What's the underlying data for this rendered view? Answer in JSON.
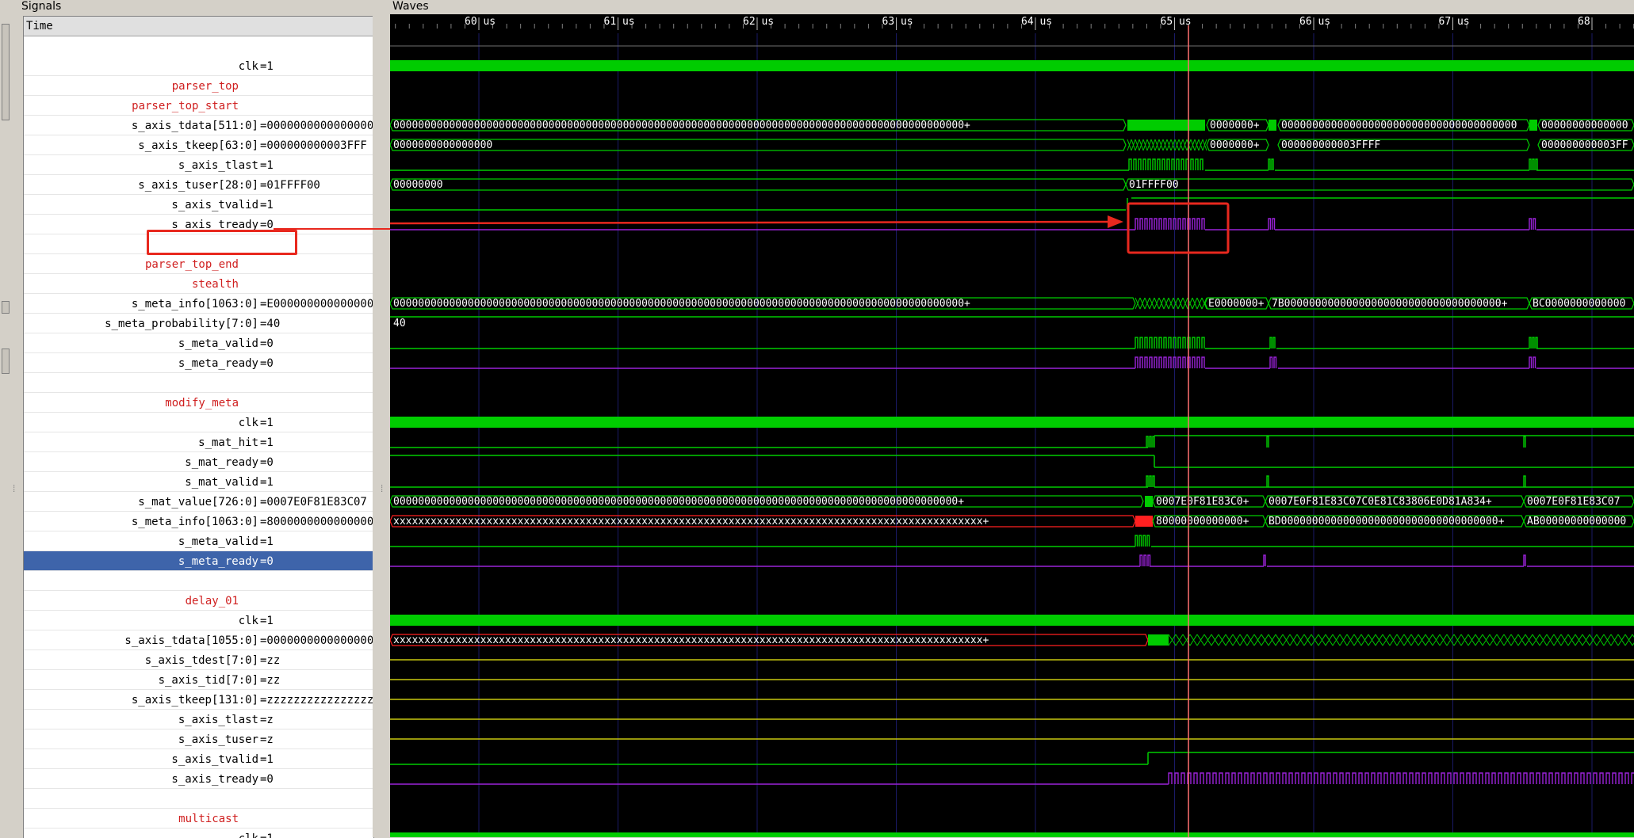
{
  "panels": {
    "signals_title": "Signals",
    "waves_title": "Waves"
  },
  "signals": {
    "header": "Time",
    "rows": [
      {
        "name": "clk",
        "value": "=1"
      },
      {
        "name": "parser_top",
        "value": "",
        "group": true
      },
      {
        "name": "parser_top_start",
        "value": "",
        "group": true
      },
      {
        "name": "s_axis_tdata[511:0]",
        "value": "=0000000000000000"
      },
      {
        "name": "s_axis_tkeep[63:0]",
        "value": "=000000000003FFF"
      },
      {
        "name": "s_axis_tlast",
        "value": "=1"
      },
      {
        "name": "s_axis_tuser[28:0]",
        "value": "=01FFFF00"
      },
      {
        "name": "s_axis_tvalid",
        "value": "=1"
      },
      {
        "name": "s_axis_tready",
        "value": "=0"
      },
      {
        "name": "",
        "value": ""
      },
      {
        "name": "parser_top_end",
        "value": "",
        "group": true
      },
      {
        "name": "stealth",
        "value": "",
        "group": true
      },
      {
        "name": "s_meta_info[1063:0]",
        "value": "=E000000000000000"
      },
      {
        "name": "s_meta_probability[7:0]",
        "value": "=40"
      },
      {
        "name": "s_meta_valid",
        "value": "=0"
      },
      {
        "name": "s_meta_ready",
        "value": "=0"
      },
      {
        "name": "",
        "value": ""
      },
      {
        "name": "modify_meta",
        "value": "",
        "group": true
      },
      {
        "name": "clk",
        "value": "=1"
      },
      {
        "name": "s_mat_hit",
        "value": "=1"
      },
      {
        "name": "s_mat_ready",
        "value": "=0"
      },
      {
        "name": "s_mat_valid",
        "value": "=1"
      },
      {
        "name": "s_mat_value[726:0]",
        "value": "=0007E0F81E83C07"
      },
      {
        "name": "s_meta_info[1063:0]",
        "value": "=8000000000000000"
      },
      {
        "name": "s_meta_valid",
        "value": "=1"
      },
      {
        "name": "s_meta_ready",
        "value": "=0",
        "selected": true
      },
      {
        "name": "",
        "value": ""
      },
      {
        "name": "delay_01",
        "value": "",
        "group": true
      },
      {
        "name": "clk",
        "value": "=1"
      },
      {
        "name": "s_axis_tdata[1055:0]",
        "value": "=0000000000000000"
      },
      {
        "name": "s_axis_tdest[7:0]",
        "value": "=zz"
      },
      {
        "name": "s_axis_tid[7:0]",
        "value": "=zz"
      },
      {
        "name": "s_axis_tkeep[131:0]",
        "value": "=zzzzzzzzzzzzzzzz"
      },
      {
        "name": "s_axis_tlast",
        "value": "=z"
      },
      {
        "name": "s_axis_tuser",
        "value": "=z"
      },
      {
        "name": "s_axis_tvalid",
        "value": "=1"
      },
      {
        "name": "s_axis_tready",
        "value": "=0"
      },
      {
        "name": "",
        "value": ""
      },
      {
        "name": "multicast",
        "value": "",
        "group": true
      },
      {
        "name": "clk",
        "value": "=1"
      }
    ]
  },
  "timeline": {
    "ticks": [
      "60 us",
      "61 us",
      "62 us",
      "63 us",
      "64 us",
      "65 us",
      "66 us",
      "67 us",
      "68"
    ],
    "cursor_us": 65.1
  },
  "wave_labels": {
    "tdata_a": "00000000000000000000000000000000000000000000000000000000000000000000000000000000000000000000+",
    "tdata_b": "0000000+",
    "tdata_c": "00000000000000000000000000000000000000+",
    "tdata_d": "000000000000000000",
    "tkeep_a": "0000000000000000",
    "tkeep_b": "0000000+",
    "tkeep_c": "000000000003FFFF",
    "tkeep_d": "000000000003FF",
    "tuser_a": "00000000",
    "tuser_b": "01FFFF00",
    "meta_a": "00000000000000000000000000000000000000000000000000000000000000000000000000000000000000000000+",
    "meta_b": "E0000000+",
    "meta_c": "7B00000000000000000000000000000000000+",
    "meta_d": "BC000000000000000",
    "prob": "40",
    "mat_a": "0000000000000000000000000000000000000000000000000000000000000000000000000000000000000000000+",
    "mat_b": "0007E0F81E83C0+",
    "mat_c": "0007E0F81E83C07C0E81C83806E0D81A834+",
    "mat_d": "0007E0F81E83C07",
    "minfo_a": "xxxxxxxxxxxxxxxxxxxxxxxxxxxxxxxxxxxxxxxxxxxxxxxxxxxxxxxxxxxxxxxxxxxxxxxxxxxxxxxxxxxxxxxxxxxxxxx+",
    "minfo_b": "80000000000000+",
    "minfo_c": "BD00000000000000000000000000000000000+",
    "minfo_d": "AB00000000000000",
    "d_tdata_a": "xxxxxxxxxxxxxxxxxxxxxxxxxxxxxxxxxxxxxxxxxxxxxxxxxxxxxxxxxxxxxxxxxxxxxxxxxxxxxxxxxxxxxxxxxxxxxxx+"
  },
  "colors": {
    "wave": "#00cc00",
    "ready": "#9a22d8",
    "cursor": "#ff7070",
    "annotation": "#e8281e",
    "zstate": "#c8c810",
    "xstate": "#ff2020"
  }
}
